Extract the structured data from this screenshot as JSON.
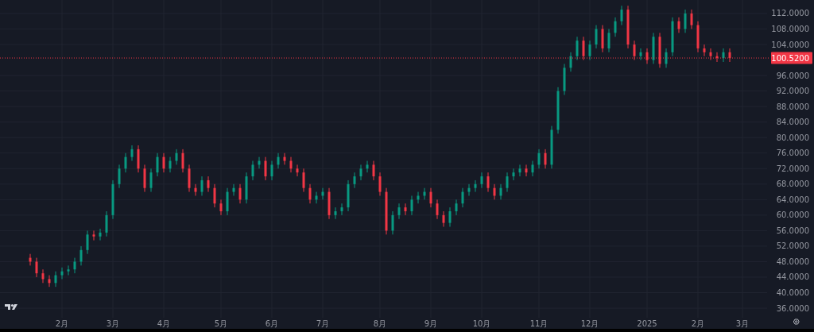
{
  "chart": {
    "chart_data": {
      "type": "candlestick",
      "ylim": [
        33.55,
        115.48
      ],
      "categories": [
        null,
        null,
        null,
        null,
        null,
        "2月",
        null,
        null,
        null,
        null,
        null,
        null,
        null,
        "3月",
        null,
        null,
        null,
        null,
        null,
        null,
        null,
        "4月",
        null,
        null,
        null,
        null,
        null,
        null,
        null,
        null,
        "5月",
        null,
        null,
        null,
        null,
        null,
        null,
        null,
        "6月",
        null,
        null,
        null,
        null,
        null,
        null,
        null,
        "7月",
        null,
        null,
        null,
        null,
        null,
        null,
        null,
        null,
        "8月",
        null,
        null,
        null,
        null,
        null,
        null,
        null,
        "9月",
        null,
        null,
        null,
        null,
        null,
        null,
        null,
        "10月",
        null,
        null,
        null,
        null,
        null,
        null,
        null,
        null,
        "11月",
        null,
        null,
        null,
        null,
        null,
        null,
        null,
        "12月",
        null,
        null,
        null,
        null,
        null,
        null,
        null,
        null,
        "2025",
        null,
        null,
        null,
        null,
        null,
        null,
        null,
        "2月",
        null,
        null,
        null,
        null,
        null,
        null,
        "3月"
      ],
      "ohlc": [
        [
          49,
          50,
          47,
          48
        ],
        [
          48,
          49,
          44,
          45
        ],
        [
          45,
          46,
          42.5,
          43.5
        ],
        [
          43.5,
          44.5,
          41.5,
          42.5
        ],
        [
          42.5,
          45.5,
          41.5,
          44.5
        ],
        [
          44.5,
          46.5,
          43.5,
          45.5
        ],
        [
          45.5,
          47,
          44.5,
          46
        ],
        [
          46,
          49,
          45,
          48
        ],
        [
          48,
          52,
          47,
          51
        ],
        [
          51,
          56,
          50,
          55
        ],
        [
          55,
          56,
          53.5,
          54.5
        ],
        [
          54.5,
          56.5,
          53.5,
          55.5
        ],
        [
          55.5,
          61,
          54.5,
          60
        ],
        [
          60,
          69,
          59,
          68
        ],
        [
          68,
          73,
          67,
          72
        ],
        [
          72,
          76,
          71,
          75
        ],
        [
          75,
          78,
          74,
          77
        ],
        [
          77,
          78,
          71,
          72
        ],
        [
          72,
          73,
          66,
          67
        ],
        [
          67,
          72,
          66,
          71
        ],
        [
          71,
          76,
          70,
          75
        ],
        [
          75,
          76,
          71,
          72
        ],
        [
          72,
          75,
          71,
          74
        ],
        [
          74,
          77,
          73,
          76
        ],
        [
          76,
          77,
          71,
          72
        ],
        [
          72,
          73,
          66,
          67
        ],
        [
          67,
          68,
          65,
          66
        ],
        [
          66,
          70,
          65,
          69
        ],
        [
          69,
          70,
          66,
          67
        ],
        [
          67,
          68,
          62,
          63
        ],
        [
          63,
          64,
          60,
          61
        ],
        [
          61,
          67,
          60,
          66
        ],
        [
          66,
          68,
          65,
          67
        ],
        [
          67,
          68,
          63,
          64
        ],
        [
          64,
          71,
          63,
          70
        ],
        [
          70,
          74,
          69,
          73
        ],
        [
          73,
          75,
          72,
          74
        ],
        [
          74,
          75,
          69,
          70
        ],
        [
          70,
          74,
          69,
          73
        ],
        [
          73,
          76,
          72,
          75
        ],
        [
          75,
          76,
          73,
          74
        ],
        [
          74,
          75,
          71,
          72
        ],
        [
          72,
          73,
          70,
          71
        ],
        [
          71,
          72,
          66,
          67
        ],
        [
          67,
          68,
          63,
          64
        ],
        [
          64,
          66,
          63,
          65
        ],
        [
          65,
          67,
          64,
          66
        ],
        [
          66,
          67,
          59,
          60
        ],
        [
          60,
          62,
          59,
          61
        ],
        [
          61,
          63,
          60,
          62
        ],
        [
          62,
          69,
          61,
          68
        ],
        [
          68,
          71,
          67,
          70
        ],
        [
          70,
          73,
          69,
          72
        ],
        [
          72,
          74,
          71,
          73
        ],
        [
          73,
          74,
          69,
          70
        ],
        [
          70,
          71,
          65,
          66
        ],
        [
          66,
          67,
          55,
          56
        ],
        [
          56,
          61,
          55,
          60
        ],
        [
          60,
          63,
          59,
          62
        ],
        [
          62,
          63,
          60,
          61
        ],
        [
          61,
          65,
          60,
          64
        ],
        [
          64,
          66,
          63,
          65
        ],
        [
          65,
          67,
          64,
          66
        ],
        [
          66,
          67,
          62,
          63
        ],
        [
          63,
          64,
          59,
          60
        ],
        [
          60,
          61,
          57,
          58
        ],
        [
          58,
          62,
          57,
          61
        ],
        [
          61,
          64,
          60,
          63
        ],
        [
          63,
          67,
          62,
          66
        ],
        [
          66,
          68,
          65,
          67
        ],
        [
          67,
          69,
          66,
          68
        ],
        [
          68,
          71,
          67,
          70
        ],
        [
          70,
          71,
          66,
          67
        ],
        [
          67,
          68,
          64,
          65
        ],
        [
          65,
          68,
          64,
          67
        ],
        [
          67,
          71,
          66,
          70
        ],
        [
          70,
          72,
          69,
          71
        ],
        [
          71,
          73,
          70,
          72
        ],
        [
          72,
          73,
          70,
          71
        ],
        [
          71,
          74,
          70,
          73
        ],
        [
          73,
          77,
          72,
          76
        ],
        [
          76,
          77,
          72,
          73
        ],
        [
          73,
          83,
          72,
          82
        ],
        [
          82,
          93,
          81,
          92
        ],
        [
          92,
          99,
          91,
          98
        ],
        [
          98,
          102,
          97,
          101
        ],
        [
          101,
          106,
          100,
          105
        ],
        [
          105,
          106,
          100,
          101
        ],
        [
          101,
          105,
          100,
          104
        ],
        [
          104,
          109,
          103,
          108
        ],
        [
          108,
          109,
          102,
          103
        ],
        [
          103,
          108,
          102,
          107
        ],
        [
          107,
          111,
          106,
          110
        ],
        [
          110,
          114,
          109,
          113
        ],
        [
          113,
          114,
          103,
          104
        ],
        [
          104,
          105,
          100,
          101
        ],
        [
          101,
          103,
          100,
          102
        ],
        [
          102,
          103,
          99,
          100
        ],
        [
          100,
          107,
          99,
          106
        ],
        [
          106,
          107,
          98,
          99
        ],
        [
          99,
          103,
          98,
          102
        ],
        [
          102,
          111,
          101,
          110
        ],
        [
          110,
          111,
          107,
          108
        ],
        [
          108,
          113,
          107,
          112
        ],
        [
          112,
          113,
          108,
          109
        ],
        [
          109,
          110,
          102,
          103
        ],
        [
          103,
          104,
          101,
          102
        ],
        [
          102,
          103,
          100,
          101
        ],
        [
          101,
          102,
          99.5,
          100.5
        ],
        [
          100.5,
          103,
          99.5,
          102
        ],
        [
          102,
          103,
          99.5,
          100.5
        ],
        null,
        null
      ],
      "yticks": [
        {
          "value": 36,
          "label": "36.0000"
        },
        {
          "value": 40,
          "label": "40.0000"
        },
        {
          "value": 44,
          "label": "44.0000"
        },
        {
          "value": 48,
          "label": "48.0000"
        },
        {
          "value": 52,
          "label": "52.0000"
        },
        {
          "value": 56,
          "label": "56.0000"
        },
        {
          "value": 60,
          "label": "60.0000"
        },
        {
          "value": 64,
          "label": "64.0000"
        },
        {
          "value": 68,
          "label": "68.0000"
        },
        {
          "value": 72,
          "label": "72.0000"
        },
        {
          "value": 76,
          "label": "76.0000"
        },
        {
          "value": 80,
          "label": "80.0000"
        },
        {
          "value": 84,
          "label": "84.0000"
        },
        {
          "value": 88,
          "label": "88.0000"
        },
        {
          "value": 92,
          "label": "92.0000"
        },
        {
          "value": 96,
          "label": "96.0000"
        },
        {
          "value": 104,
          "label": "104.0000"
        },
        {
          "value": 108,
          "label": "108.0000"
        },
        {
          "value": 112,
          "label": "112.0000"
        }
      ],
      "grid": true,
      "ref_lines": [
        {
          "axis": "y",
          "value": 100.52,
          "label": "100.5200"
        }
      ]
    }
  }
}
